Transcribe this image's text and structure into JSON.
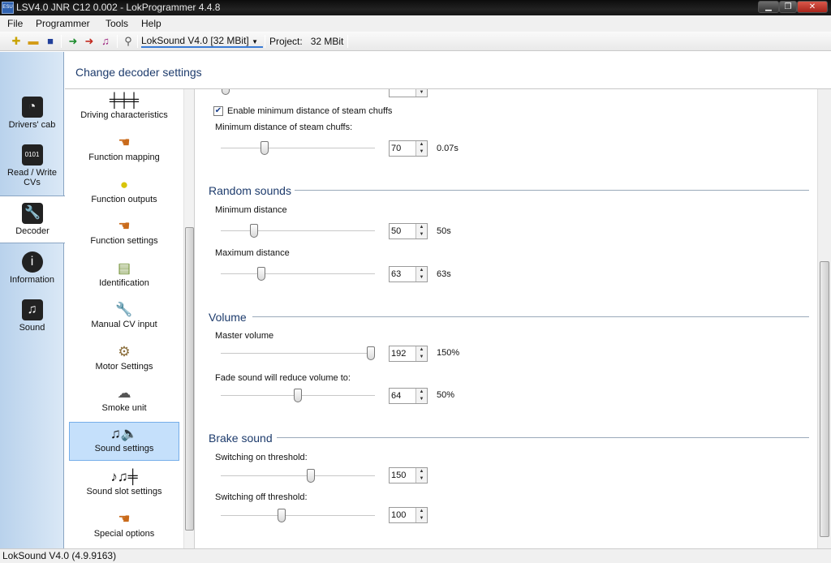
{
  "window": {
    "title": "LSV4.0 JNR C12 0.002 - LokProgrammer 4.4.8",
    "app_icon_text": "ESU"
  },
  "menu": [
    "File",
    "Programmer",
    "Tools",
    "Help"
  ],
  "toolbar": {
    "decoder_select": "LokSound V4.0 [32 MBit]",
    "project_label": "Project:",
    "project_value": "32 MBit"
  },
  "nav": [
    {
      "label": "Drivers' cab",
      "icon": "gauge-icon"
    },
    {
      "label": "Read / Write CVs",
      "icon": "binary-icon"
    },
    {
      "label": "Decoder",
      "icon": "wrench-icon"
    },
    {
      "label": "Information",
      "icon": "info-icon"
    },
    {
      "label": "Sound",
      "icon": "music-icon"
    }
  ],
  "header": {
    "title": "Change decoder settings"
  },
  "categories": [
    {
      "label": "Driving characteristics",
      "icon": "sliders-icon"
    },
    {
      "label": "Function mapping",
      "icon": "hand-buttons-icon"
    },
    {
      "label": "Function outputs",
      "icon": "lightbulb-icon"
    },
    {
      "label": "Function settings",
      "icon": "hand-buttons-icon"
    },
    {
      "label": "Identification",
      "icon": "id-card-icon"
    },
    {
      "label": "Manual CV input",
      "icon": "wrench-cv-icon"
    },
    {
      "label": "Motor Settings",
      "icon": "motor-icon"
    },
    {
      "label": "Smoke unit",
      "icon": "smoke-icon"
    },
    {
      "label": "Sound settings",
      "icon": "notes-speaker-icon"
    },
    {
      "label": "Sound slot settings",
      "icon": "notes-sliders-icon"
    },
    {
      "label": "Special options",
      "icon": "hand-buttons-icon"
    }
  ],
  "steam": {
    "checkbox_label": "Enable minimum distance of steam chuffs",
    "checked": true,
    "min_distance_label": "Minimum distance of steam chuffs:",
    "min_distance_value": "70",
    "min_distance_unit": "0.07s"
  },
  "random_sounds": {
    "title": "Random sounds",
    "min_label": "Minimum distance",
    "min_value": "50",
    "min_unit": "50s",
    "max_label": "Maximum distance",
    "max_value": "63",
    "max_unit": "63s"
  },
  "volume": {
    "title": "Volume",
    "master_label": "Master volume",
    "master_value": "192",
    "master_unit": "150%",
    "fade_label": "Fade sound will reduce volume to:",
    "fade_value": "64",
    "fade_unit": "50%"
  },
  "brake": {
    "title": "Brake sound",
    "on_label": "Switching on threshold:",
    "on_value": "150",
    "off_label": "Switching off threshold:",
    "off_value": "100"
  },
  "sliders": {
    "steam_min": 0.27,
    "random_min": 0.2,
    "random_max": 0.25,
    "master": 1.0,
    "fade": 0.5,
    "brake_on": 0.59,
    "brake_off": 0.39
  },
  "status": {
    "text": "LokSound V4.0 (4.9.9163)"
  }
}
